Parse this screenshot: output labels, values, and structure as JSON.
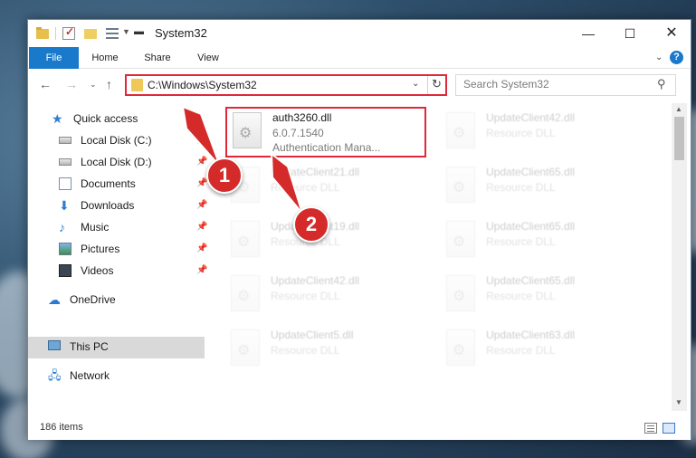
{
  "window": {
    "title": "System32",
    "controls": {
      "minimize": "—",
      "maximize": "☐",
      "close": "✕"
    }
  },
  "ribbon": {
    "tabs": [
      "File",
      "Home",
      "Share",
      "View"
    ],
    "help": "?"
  },
  "navigation": {
    "address_path": "C:\\Windows\\System32",
    "search_placeholder": "Search System32"
  },
  "sidebar": {
    "items": [
      {
        "label": "Quick access",
        "icon": "star-icon"
      },
      {
        "label": "Local Disk (C:)",
        "icon": "drive-icon",
        "pinned": true
      },
      {
        "label": "Local Disk (D:)",
        "icon": "drive-icon",
        "pinned": true
      },
      {
        "label": "Documents",
        "icon": "document-icon",
        "pinned": true
      },
      {
        "label": "Downloads",
        "icon": "download-icon",
        "pinned": true
      },
      {
        "label": "Music",
        "icon": "music-icon",
        "pinned": true
      },
      {
        "label": "Pictures",
        "icon": "pictures-icon",
        "pinned": true
      },
      {
        "label": "Videos",
        "icon": "video-icon",
        "pinned": true
      },
      {
        "label": "OneDrive",
        "icon": "cloud-icon"
      },
      {
        "label": "This PC",
        "icon": "computer-icon",
        "selected": true
      },
      {
        "label": "Network",
        "icon": "network-icon"
      }
    ]
  },
  "files": [
    {
      "name": "auth3260.dll",
      "version": "6.0.7.1540",
      "description": "Authentication Mana...",
      "highlighted": true
    },
    {
      "name": "UpdateClient42.dll",
      "type": "Resource DLL"
    },
    {
      "name": "UpdateClient21.dll",
      "type": "Resource DLL"
    },
    {
      "name": "UpdateClient65.dll",
      "type": "Resource DLL"
    },
    {
      "name": "UpdateClient19.dll",
      "type": "Resource DLL"
    },
    {
      "name": "UpdateClient65.dll",
      "type": "Resource DLL"
    },
    {
      "name": "UpdateClient42.dll",
      "type": "Resource DLL"
    },
    {
      "name": "UpdateClient65.dll",
      "type": "Resource DLL"
    },
    {
      "name": "UpdateClient5.dll",
      "type": "Resource DLL"
    },
    {
      "name": "UpdateClient63.dll",
      "type": "Resource DLL"
    }
  ],
  "status": {
    "item_count": "186 items"
  },
  "annotations": {
    "badge1": "1",
    "badge2": "2",
    "color": "#d42a2a"
  }
}
